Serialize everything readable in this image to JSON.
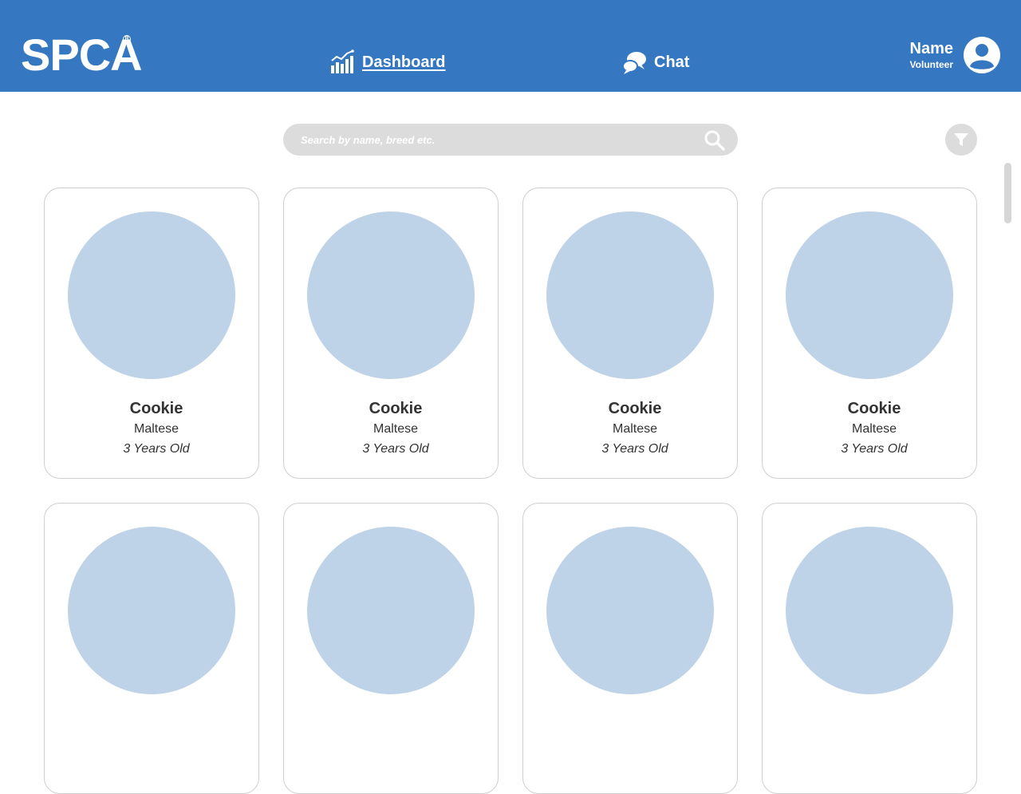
{
  "header": {
    "logo": "SPCA",
    "logo_mark": "R",
    "background": "#3578c1"
  },
  "nav": {
    "dashboard": {
      "label": "Dashboard",
      "icon": "bar-chart-icon",
      "active": true
    },
    "chat": {
      "label": "Chat",
      "icon": "chat-bubbles-icon"
    }
  },
  "user": {
    "name": "Name",
    "role": "Volunteer",
    "icon": "user-avatar-icon"
  },
  "search": {
    "placeholder": "Search by name, breed etc.",
    "value": "",
    "icon": "search-icon"
  },
  "filter": {
    "icon": "filter-icon"
  },
  "pets": [
    {
      "name": "Cookie",
      "breed": "Maltese",
      "age": "3 Years Old"
    },
    {
      "name": "Cookie",
      "breed": "Maltese",
      "age": "3 Years Old"
    },
    {
      "name": "Cookie",
      "breed": "Maltese",
      "age": "3 Years Old"
    },
    {
      "name": "Cookie",
      "breed": "Maltese",
      "age": "3 Years Old"
    },
    {
      "name": "",
      "breed": "",
      "age": ""
    },
    {
      "name": "",
      "breed": "",
      "age": ""
    },
    {
      "name": "",
      "breed": "",
      "age": ""
    },
    {
      "name": "",
      "breed": "",
      "age": ""
    }
  ],
  "colors": {
    "accent": "#3578c1",
    "photo_placeholder": "#bed3e7",
    "search_bg": "#dcdcdc"
  }
}
